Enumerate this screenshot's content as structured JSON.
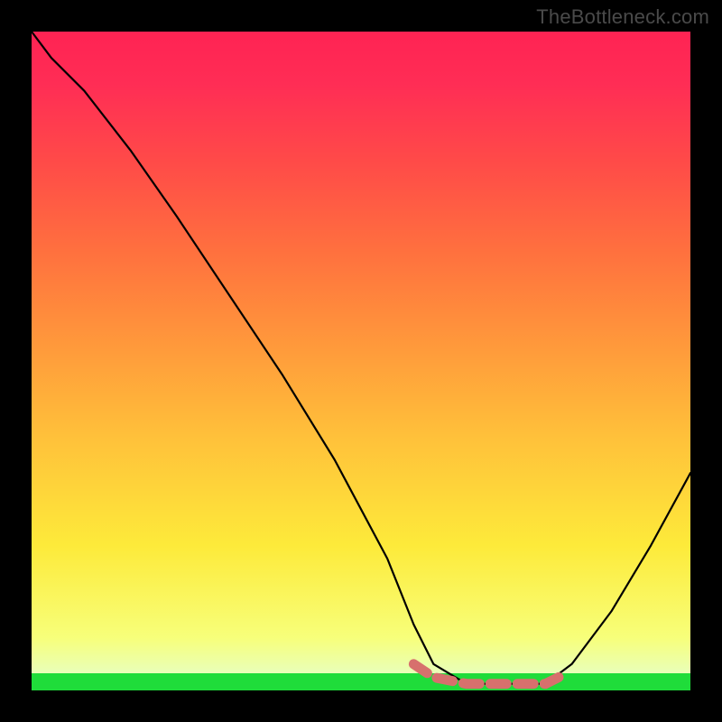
{
  "watermark": "TheBottleneck.com",
  "colors": {
    "gradient_top": "#ff2353",
    "gradient_mid": "#fdea3a",
    "gradient_bottom": "#1fdc3a",
    "curve": "#000000",
    "highlight": "#d7706d",
    "frame": "#000000"
  },
  "chart_data": {
    "type": "line",
    "title": "",
    "xlabel": "",
    "ylabel": "",
    "xlim": [
      0,
      100
    ],
    "ylim": [
      0,
      100
    ],
    "grid": false,
    "legend": false,
    "notes": "Axes have no visible tick labels; values are pixel-fraction estimates read from the image (0 = left/bottom, 100 = right/top). The curve starts at the top-left, descends to a near-zero flat trough around x≈60–78, then rises toward the right edge.",
    "series": [
      {
        "name": "curve",
        "x": [
          0,
          3,
          8,
          15,
          22,
          30,
          38,
          46,
          54,
          58,
          61,
          66,
          72,
          78,
          82,
          88,
          94,
          100
        ],
        "y": [
          100,
          96,
          91,
          82,
          72,
          60,
          48,
          35,
          20,
          10,
          4,
          1,
          1,
          1,
          4,
          12,
          22,
          33
        ]
      }
    ],
    "highlight_segment": {
      "name": "trough-dash",
      "style": "dashed",
      "color": "#d7706d",
      "x": [
        58,
        61,
        66,
        72,
        78,
        80
      ],
      "y": [
        4,
        2,
        1,
        1,
        1,
        2
      ]
    },
    "background_gradient": {
      "direction": "bottom-to-top",
      "stops": [
        {
          "pos": 0.0,
          "color": "#1fdc3a"
        },
        {
          "pos": 0.026,
          "color": "#1fdc3a"
        },
        {
          "pos": 0.026,
          "color": "#e9ffb9"
        },
        {
          "pos": 0.08,
          "color": "#f7ff7a"
        },
        {
          "pos": 0.22,
          "color": "#fdea3a"
        },
        {
          "pos": 0.38,
          "color": "#ffc23a"
        },
        {
          "pos": 0.52,
          "color": "#ff9a3b"
        },
        {
          "pos": 0.66,
          "color": "#ff723e"
        },
        {
          "pos": 0.8,
          "color": "#ff4b48"
        },
        {
          "pos": 0.92,
          "color": "#ff2d55"
        },
        {
          "pos": 1.0,
          "color": "#ff2353"
        }
      ]
    }
  }
}
